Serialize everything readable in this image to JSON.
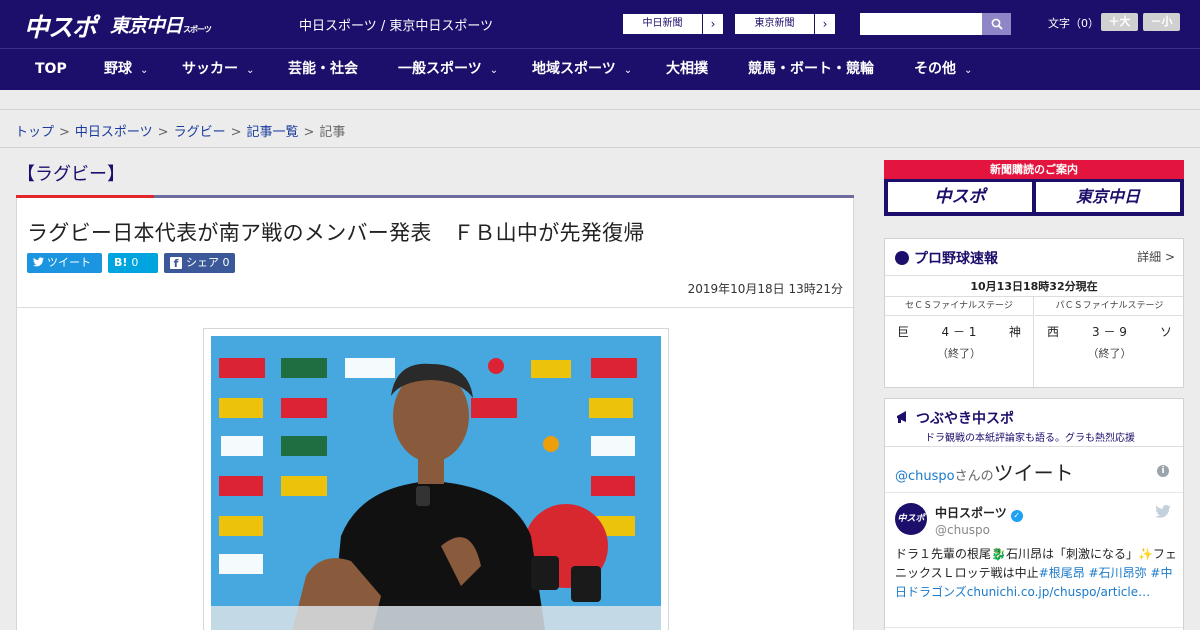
{
  "header": {
    "logo_main": "中スポ",
    "logo_sub": "東京中日",
    "logo_sub_small": "スポーツ",
    "site_links": "中日スポーツ / 東京中日スポーツ",
    "ext_link_1": "中日新聞",
    "ext_link_2": "東京新聞",
    "search_placeholder": "",
    "font_size_label": "文字（0）",
    "font_larger": "＋大",
    "font_smaller": "－小"
  },
  "nav": {
    "items": [
      {
        "label": "TOP",
        "dropdown": false
      },
      {
        "label": "野球",
        "dropdown": true
      },
      {
        "label": "サッカー",
        "dropdown": true
      },
      {
        "label": "芸能・社会",
        "dropdown": false
      },
      {
        "label": "一般スポーツ",
        "dropdown": true
      },
      {
        "label": "地域スポーツ",
        "dropdown": true
      },
      {
        "label": "大相撲",
        "dropdown": false
      },
      {
        "label": "競馬・ボート・競輪",
        "dropdown": false
      },
      {
        "label": "その他",
        "dropdown": true
      }
    ],
    "chevron": "⌄"
  },
  "breadcrumb": {
    "items": [
      "トップ",
      "中日スポーツ",
      "ラグビー",
      "記事一覧"
    ],
    "current": "記事",
    "separator": ">"
  },
  "article": {
    "category": "【ラグビー】",
    "headline": "ラグビー日本代表が南ア戦のメンバー発表　ＦＢ山中が先発復帰",
    "share": {
      "tweet_label": "ツイート",
      "hatena_label": "B!",
      "hatena_count": "0",
      "facebook_label": "シェア",
      "facebook_count": "0"
    },
    "date": "2019年10月18日 13時21分"
  },
  "sidebar": {
    "promo": {
      "title": "新聞購読のご案内",
      "button_1": "中スポ",
      "button_2": "東京中日"
    },
    "baseball": {
      "title": "プロ野球速報",
      "detail": "詳細 >",
      "timestamp": "10月13日18時32分現在",
      "games": [
        {
          "stage": "セＣＳファイナルステージ",
          "home": "巨",
          "score": "4 － 1",
          "away": "神",
          "status": "（終了）"
        },
        {
          "stage": "パＣＳファイナルステージ",
          "home": "西",
          "score": "3 － 9",
          "away": "ソ",
          "status": "（終了）"
        }
      ]
    },
    "tweets": {
      "heading": "つぶやき中スポ",
      "subheading": "ドラ観戦の本紙評論家も語る。グラも熱烈応援",
      "handle_link": "@chuspo",
      "title_suffix": "さんの",
      "title_main": "ツイート",
      "account_name": "中日スポーツ",
      "account_handle": "@chuspo",
      "avatar_text": "中スポ",
      "tweet_text_1": "ドラ１先輩の根尾🐉石川昂は「刺激になる」✨フェニックスＬロッテ戦は中止",
      "tweet_tags": "#根尾昂 #石川昂弥 #中日ドラゴンズ",
      "tweet_link": "chunichi.co.jp/chuspo/article…"
    }
  },
  "colors": {
    "brand_navy": "#1c0f6b",
    "accent_red": "#e3262c",
    "link_blue": "#1c3c9c",
    "twitter_blue": "#1b95e0",
    "hatena_blue": "#00a4de",
    "facebook_blue": "#3b5998"
  }
}
